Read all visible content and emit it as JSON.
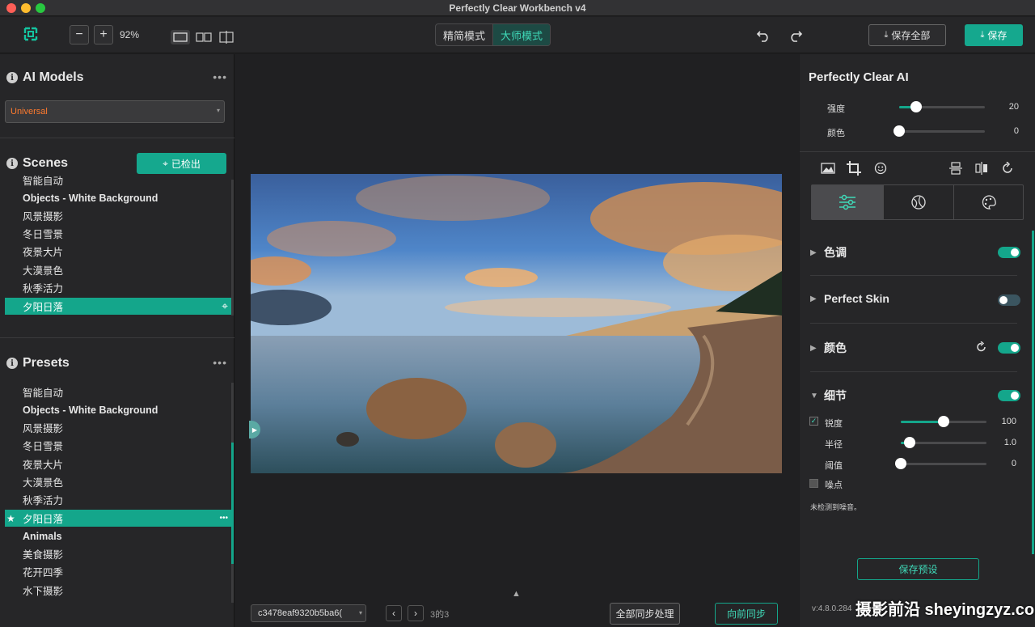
{
  "window": {
    "title": "Perfectly Clear Workbench v4"
  },
  "toolbar": {
    "zoom": "92%",
    "mode_simple": "精简模式",
    "mode_master": "大师模式",
    "save_all": "保存全部",
    "save": "保存"
  },
  "left": {
    "ai_models": {
      "title": "AI Models",
      "dropdown_value": "Universal"
    },
    "scenes": {
      "title": "Scenes",
      "detected_button": "已检出",
      "items": [
        "智能自动",
        "Objects - White Background",
        "风景摄影",
        "冬日雪景",
        "夜景大片",
        "大漠景色",
        "秋季活力",
        "夕阳日落"
      ],
      "selected_index": 7
    },
    "presets": {
      "title": "Presets",
      "items": [
        "智能自动",
        "Objects - White Background",
        "风景摄影",
        "冬日雪景",
        "夜景大片",
        "大漠景色",
        "秋季活力",
        "夕阳日落",
        "Animals",
        "美食摄影",
        "花开四季",
        "水下摄影"
      ],
      "selected_index": 7
    }
  },
  "center": {
    "file_name": "c3478eaf9320b5ba6(",
    "page_count": "3的3",
    "sync_all": "全部同步处理",
    "sync_forward": "向前同步"
  },
  "right": {
    "title": "Perfectly Clear AI",
    "strength_label": "强度",
    "strength_value": "20",
    "strength_level": 0.2,
    "color_label": "颜色",
    "color_value": "0",
    "color_level": 0,
    "sections": {
      "tone": {
        "label": "色调",
        "on": true
      },
      "skin": {
        "label": "Perfect Skin",
        "on": false
      },
      "color": {
        "label": "颜色",
        "on": true
      },
      "detail": {
        "label": "细节",
        "on": true
      }
    },
    "detail": {
      "sharpness_label": "锐度",
      "sharpness_value": "100",
      "sharpness_level": 0.5,
      "radius_label": "半径",
      "radius_value": "1.0",
      "radius_level": 0.1,
      "threshold_label": "阈值",
      "threshold_value": "0",
      "threshold_level": 0,
      "noise_label": "噪点",
      "noise_note": "未检测到噪音。"
    },
    "save_preset": "保存预设",
    "version": "v:4.8.0.284"
  },
  "watermark": "摄影前沿 sheyingzyz.com",
  "colors": {
    "accent": "#14a68b",
    "bg": "#262628"
  }
}
